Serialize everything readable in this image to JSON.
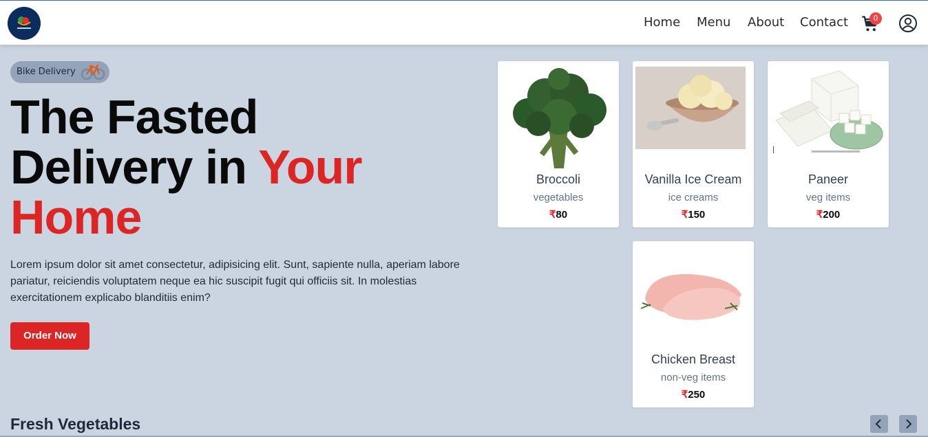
{
  "header": {
    "nav": [
      "Home",
      "Menu",
      "About",
      "Contact"
    ],
    "cart_count": "0",
    "icons": [
      "logo",
      "cart-icon",
      "user-circle-icon"
    ]
  },
  "hero": {
    "badge": "Bike Delivery",
    "title_line1": "The Fasted",
    "title_line2_a": "Delivery in ",
    "title_line2_b": "Your",
    "title_line3": "Home",
    "description": "Lorem ipsum dolor sit amet consectetur, adipisicing elit. Sunt, sapiente nulla, aperiam labore pariatur, reiciendis voluptatem neque ea hic suscipit fugit qui officiis sit. In molestias exercitationem explicabo blanditiis enim?",
    "button": "Order Now",
    "accent_color": "#dc2626"
  },
  "cards": [
    {
      "name": "Broccoli",
      "category": "vegetables",
      "currency": "₹",
      "price": "80"
    },
    {
      "name": "Vanilla Ice Cream",
      "category": "ice creams",
      "currency": "₹",
      "price": "150"
    },
    {
      "name": "Paneer",
      "category": "veg items",
      "currency": "₹",
      "price": "200"
    },
    {
      "name": "Chicken Breast",
      "category": "non-veg items",
      "currency": "₹",
      "price": "250"
    }
  ],
  "section": {
    "title": "Fresh Vegetables"
  }
}
